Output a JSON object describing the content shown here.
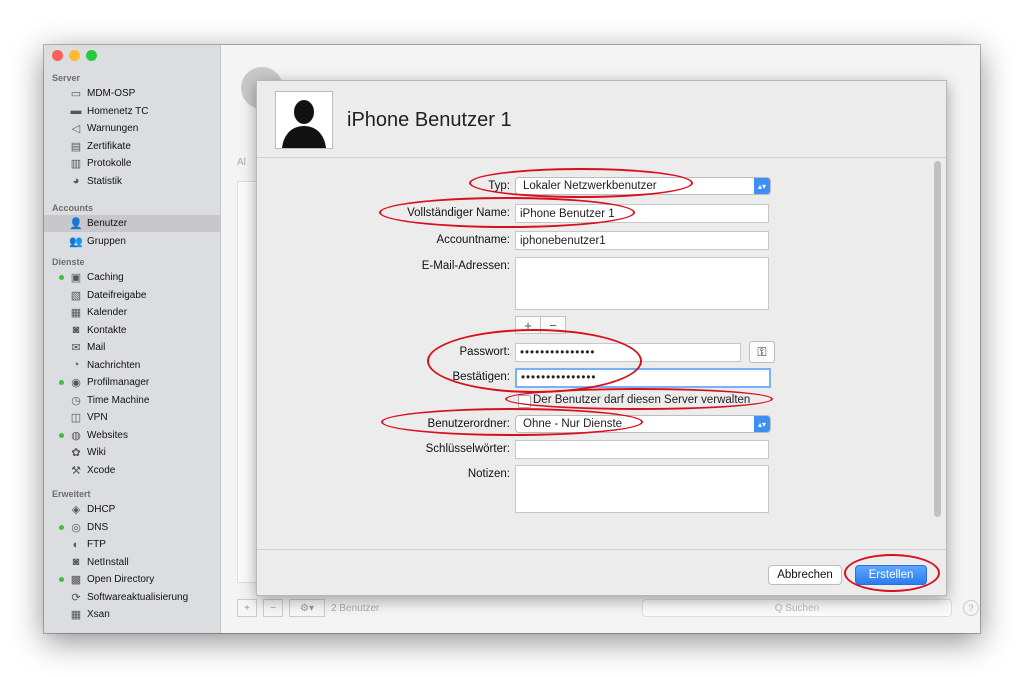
{
  "sidebar": {
    "sections": [
      {
        "label": "Server",
        "items": [
          {
            "label": "MDM-OSP",
            "icon": "display-icon",
            "glyph": "▭",
            "dot": false
          },
          {
            "label": "Homenetz TC",
            "icon": "time-capsule-icon",
            "glyph": "▬",
            "dot": false
          },
          {
            "label": "Warnungen",
            "icon": "megaphone-icon",
            "glyph": "◁",
            "dot": false
          },
          {
            "label": "Zertifikate",
            "icon": "certificate-icon",
            "glyph": "▤",
            "dot": false
          },
          {
            "label": "Protokolle",
            "icon": "log-icon",
            "glyph": "▥",
            "dot": false
          },
          {
            "label": "Statistik",
            "icon": "gauge-icon",
            "glyph": "◕",
            "dot": false
          }
        ]
      },
      {
        "label": "Accounts",
        "items": [
          {
            "label": "Benutzer",
            "icon": "user-icon",
            "glyph": "👤",
            "dot": false,
            "selected": true
          },
          {
            "label": "Gruppen",
            "icon": "group-icon",
            "glyph": "👥",
            "dot": false
          }
        ]
      },
      {
        "label": "Dienste",
        "items": [
          {
            "label": "Caching",
            "icon": "caching-icon",
            "glyph": "▣",
            "dot": true
          },
          {
            "label": "Dateifreigabe",
            "icon": "folder-share-icon",
            "glyph": "▧",
            "dot": false
          },
          {
            "label": "Kalender",
            "icon": "calendar-icon",
            "glyph": "▦",
            "dot": false
          },
          {
            "label": "Kontakte",
            "icon": "contacts-icon",
            "glyph": "◙",
            "dot": false
          },
          {
            "label": "Mail",
            "icon": "mail-icon",
            "glyph": "✉",
            "dot": false
          },
          {
            "label": "Nachrichten",
            "icon": "messages-icon",
            "glyph": "◔",
            "dot": false
          },
          {
            "label": "Profilmanager",
            "icon": "profile-manager-icon",
            "glyph": "◉",
            "dot": true
          },
          {
            "label": "Time Machine",
            "icon": "time-machine-icon",
            "glyph": "◷",
            "dot": false
          },
          {
            "label": "VPN",
            "icon": "vpn-icon",
            "glyph": "◫",
            "dot": false
          },
          {
            "label": "Websites",
            "icon": "globe-icon",
            "glyph": "◍",
            "dot": true
          },
          {
            "label": "Wiki",
            "icon": "wiki-icon",
            "glyph": "✿",
            "dot": false
          },
          {
            "label": "Xcode",
            "icon": "hammer-icon",
            "glyph": "⚒",
            "dot": false
          }
        ]
      },
      {
        "label": "Erweitert",
        "items": [
          {
            "label": "DHCP",
            "icon": "dhcp-icon",
            "glyph": "◈",
            "dot": false
          },
          {
            "label": "DNS",
            "icon": "dns-icon",
            "glyph": "◎",
            "dot": true
          },
          {
            "label": "FTP",
            "icon": "ftp-icon",
            "glyph": "◐",
            "dot": false
          },
          {
            "label": "NetInstall",
            "icon": "netinstall-icon",
            "glyph": "◙",
            "dot": false
          },
          {
            "label": "Open Directory",
            "icon": "open-directory-icon",
            "glyph": "▩",
            "dot": true
          },
          {
            "label": "Softwareaktualisierung",
            "icon": "software-update-icon",
            "glyph": "⟳",
            "dot": false
          },
          {
            "label": "Xsan",
            "icon": "xsan-icon",
            "glyph": "▦",
            "dot": false
          }
        ]
      }
    ]
  },
  "background": {
    "filter_prefix": "Al",
    "bottom_status": "2 Benutzer",
    "search_placeholder": "Q Suchen",
    "help": "?"
  },
  "sheet": {
    "title": "iPhone Benutzer 1",
    "typ_label": "Typ:",
    "typ_value": "Lokaler Netzwerkbenutzer",
    "fullname_label": "Vollständiger Name:",
    "fullname_value": "iPhone Benutzer 1",
    "account_label": "Accountname:",
    "account_value": "iphonebenutzer1",
    "email_label": "E-Mail-Adressen:",
    "plus": "+",
    "minus": "−",
    "password_label": "Passwort:",
    "password_value": "•••••••••••••••",
    "confirm_label": "Bestätigen:",
    "confirm_value": "•••••••••••••••",
    "key_glyph": "⚿",
    "admin_checkbox_label": "Der Benutzer darf diesen Server verwalten",
    "homefolder_label": "Benutzerordner:",
    "homefolder_value": "Ohne - Nur Dienste",
    "keywords_label": "Schlüsselwörter:",
    "notes_label": "Notizen:",
    "cancel_label": "Abbrechen",
    "create_label": "Erstellen"
  },
  "colors": {
    "accent": "#2a7cf0",
    "annotation_ring": "#d8101e",
    "status_dot": "#3fbf3f"
  }
}
